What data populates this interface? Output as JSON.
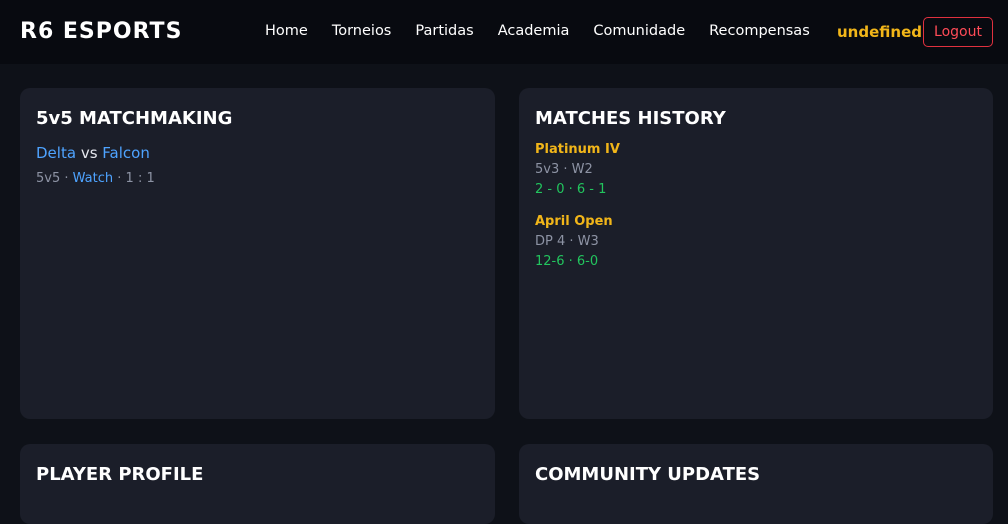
{
  "header": {
    "brand": "R6 ESPORTS",
    "nav": [
      "Home",
      "Torneios",
      "Partidas",
      "Academia",
      "Comunidade",
      "Recompensas"
    ],
    "username": "undefined",
    "logout_label": "Logout"
  },
  "matchmaking": {
    "title": "5v5 MATCHMAKING",
    "team_a": "Delta",
    "vs": "vs",
    "team_b": "Falcon",
    "mode": "5v5",
    "sep1": " · ",
    "watch_label": "Watch",
    "sep2": " · ",
    "score": "1 : 1"
  },
  "history": {
    "title": "MATCHES HISTORY",
    "items": [
      {
        "name": "Platinum IV",
        "meta": "5v3 · W2",
        "score": "2 - 0 · 6 - 1"
      },
      {
        "name": "April Open",
        "meta": "DP 4 · W3",
        "score": "12-6 · 6-0"
      }
    ]
  },
  "profile": {
    "title": "PLAYER PROFILE"
  },
  "community": {
    "title": "COMMUNITY UPDATES"
  },
  "colors": {
    "accent_gold": "#f2b619",
    "link_blue": "#4ea3ff",
    "win_green": "#22c55e",
    "logout_red": "#e0313f"
  }
}
